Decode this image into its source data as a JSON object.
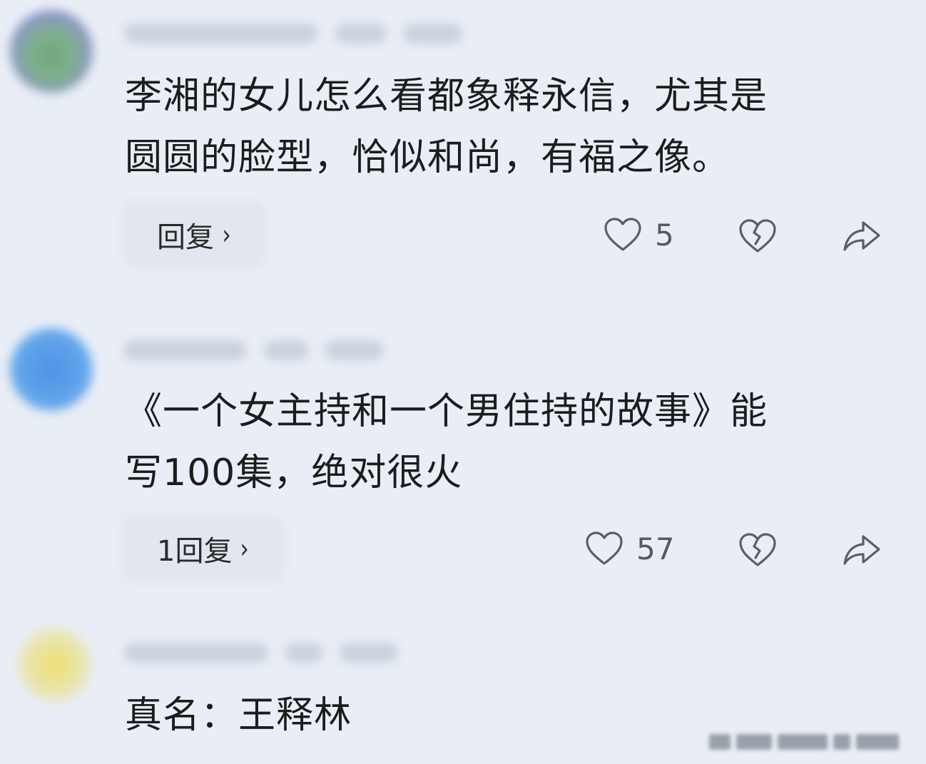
{
  "comments": [
    {
      "avatar_color": "#7da68c",
      "text": "李湘的女儿怎么看都象释永信，尤其是\n圆圆的脸型，恰似和尚，有福之像。",
      "reply_label": "回复",
      "like_count": "5",
      "like_icon": "heart-outline-icon",
      "dislike_icon": "broken-heart-icon",
      "share_icon": "share-arrow-icon"
    },
    {
      "avatar_color": "#5b9ee6",
      "text": "《一个女主持和一个男住持的故事》能\n写100集，绝对很火",
      "reply_label": "1回复",
      "like_count": "57",
      "like_icon": "heart-outline-icon",
      "dislike_icon": "broken-heart-icon",
      "share_icon": "share-arrow-icon"
    },
    {
      "avatar_color": "#e6df8c",
      "text": "真名：王释林"
    }
  ]
}
